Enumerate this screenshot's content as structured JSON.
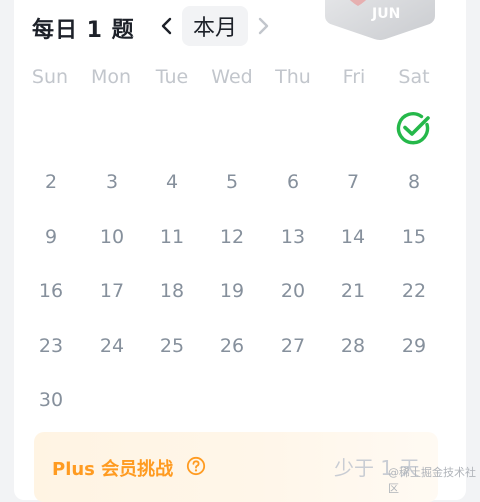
{
  "header": {
    "title": "每日 1 题",
    "current_month_label": "本月",
    "badge_text": "JUN"
  },
  "weekdays": [
    "Sun",
    "Mon",
    "Tue",
    "Wed",
    "Thu",
    "Fri",
    "Sat"
  ],
  "calendar": {
    "checked_day": 1,
    "weeks": [
      [
        2,
        3,
        4,
        5,
        6,
        7,
        8
      ],
      [
        9,
        10,
        11,
        12,
        13,
        14,
        15
      ],
      [
        16,
        17,
        18,
        19,
        20,
        21,
        22
      ],
      [
        23,
        24,
        25,
        26,
        27,
        28,
        29
      ],
      [
        30
      ]
    ]
  },
  "plus": {
    "label": "Plus 会员挑战",
    "status": "少于 1 天"
  },
  "watermark": "@稀土掘金技术社区",
  "colors": {
    "accent_orange": "#ff9b21",
    "check_green": "#25b84a",
    "day_text": "#86909c"
  }
}
